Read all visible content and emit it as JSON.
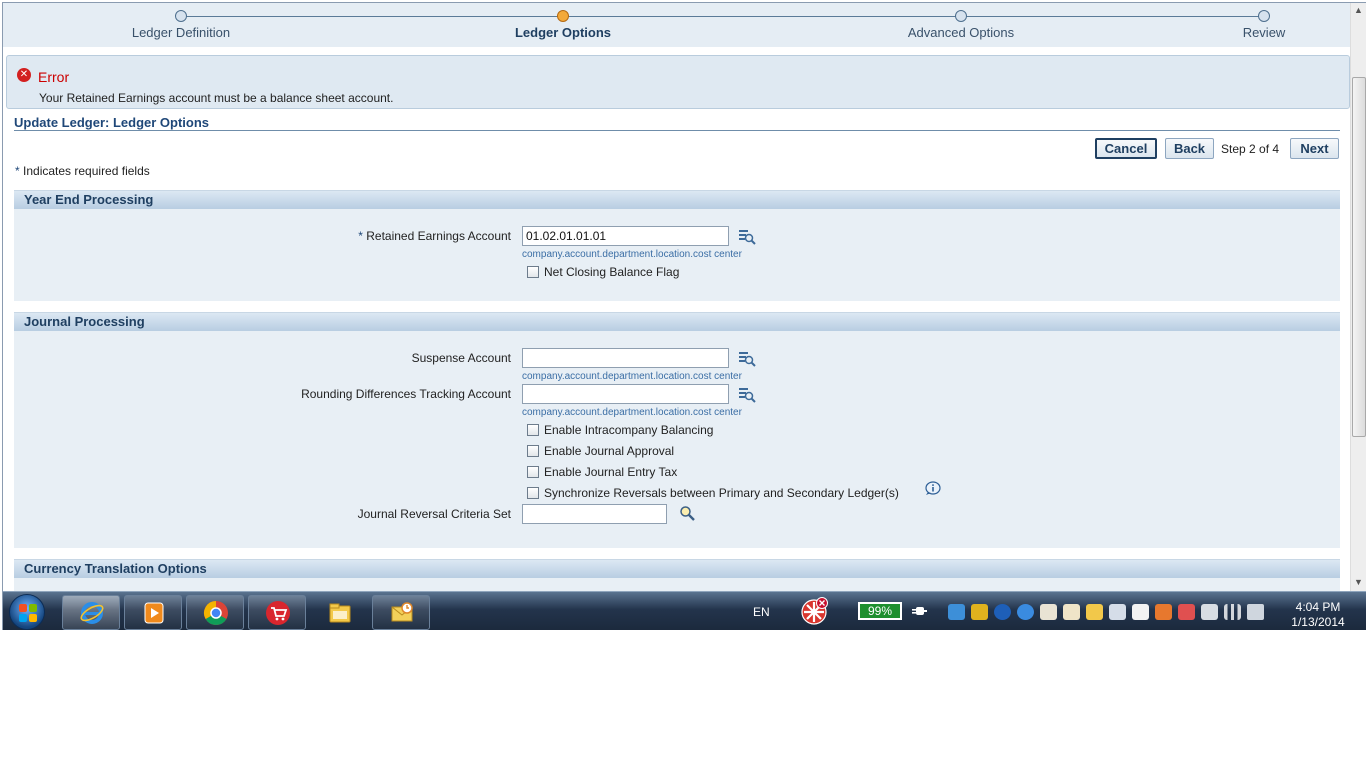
{
  "train": {
    "steps": [
      {
        "label": "Ledger Definition"
      },
      {
        "label": "Ledger Options"
      },
      {
        "label": "Advanced Options"
      },
      {
        "label": "Review"
      }
    ],
    "active_step": 2
  },
  "error": {
    "title": "Error",
    "message": "Your Retained Earnings account must be a balance sheet account."
  },
  "page": {
    "title": "Update Ledger: Ledger Options",
    "required_note": "Indicates required fields",
    "required_star": "*"
  },
  "buttons": {
    "cancel": "Cancel",
    "back": "Back",
    "next": "Next",
    "step_text": "Step 2 of 4"
  },
  "year_end": {
    "header": "Year End Processing",
    "retained_label": "Retained Earnings Account",
    "retained_value": "01.02.01.01.01",
    "retained_hint": "company.account.department.location.cost center",
    "net_closing_label": "Net Closing Balance Flag"
  },
  "journal": {
    "header": "Journal Processing",
    "suspense_label": "Suspense Account",
    "suspense_value": "",
    "suspense_hint": "company.account.department.location.cost center",
    "rounding_label": "Rounding Differences Tracking Account",
    "rounding_value": "",
    "rounding_hint": "company.account.department.location.cost center",
    "checkboxes": [
      "Enable Intracompany Balancing",
      "Enable Journal Approval",
      "Enable Journal Entry Tax",
      "Synchronize Reversals between Primary and Secondary Ledger(s)"
    ],
    "reversal_label": "Journal Reversal Criteria Set",
    "reversal_value": ""
  },
  "currency": {
    "header": "Currency Translation Options"
  },
  "taskbar": {
    "language": "EN",
    "battery": "99%",
    "time": "4:04 PM",
    "date": "1/13/2014",
    "apps": [
      "internet-explorer-icon",
      "media-player-icon",
      "chrome-icon",
      "shopping-cart-icon",
      "file-explorer-icon",
      "outlook-icon"
    ]
  },
  "colors": {
    "accent": "#1f4778",
    "error": "#cc0000",
    "active_step": "#f3a93a",
    "section_bg": "#e8eff5"
  }
}
